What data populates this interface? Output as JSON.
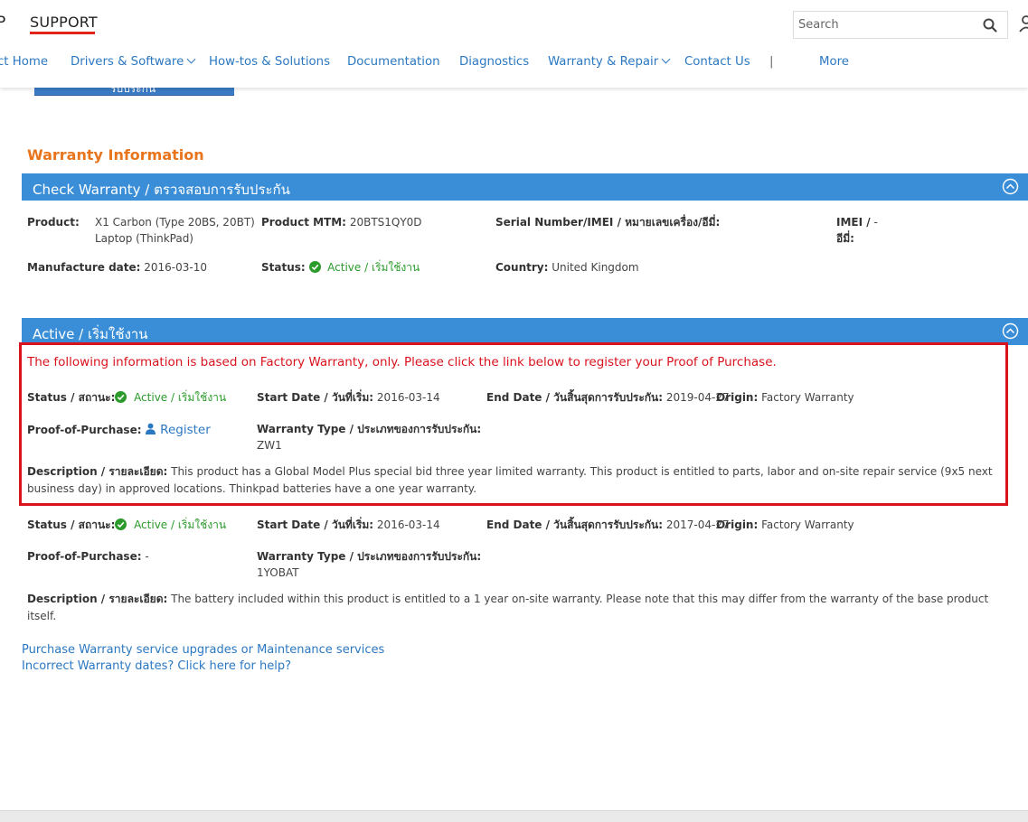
{
  "header": {
    "brand_fragment": "P",
    "support": "SUPPORT",
    "search_placeholder": "Search",
    "colors": {
      "accent": "#e2231a",
      "link": "#2b78c2"
    }
  },
  "nav": {
    "items": [
      {
        "label": "ct Home"
      },
      {
        "label": "Drivers & Software"
      },
      {
        "label": "How-tos & Solutions"
      },
      {
        "label": "Documentation"
      },
      {
        "label": "Diagnostics"
      },
      {
        "label": "Warranty & Repair"
      },
      {
        "label": "Contact Us"
      }
    ],
    "separator": "|",
    "more": "More"
  },
  "peek_button_label": "รับประกัน",
  "warranty": {
    "title": "Warranty Information",
    "check_bar": "Check Warranty / ตรวจสอบการรับประกัน",
    "product_label": "Product:",
    "product_value_line1": "X1 Carbon (Type 20BS, 20BT)",
    "product_value_line2": "Laptop (ThinkPad)",
    "mtm_label": "Product MTM:",
    "mtm_value": "20BTS1QY0D",
    "serial_label": "Serial Number/IMEI / หมายเลขเครื่อง/อีมี่:",
    "imei_label_line1": "IMEI /",
    "imei_label_line2": "อีมี่:",
    "imei_value": "-",
    "mfg_label": "Manufacture date:",
    "mfg_value": "2016-03-10",
    "status_label": "Status:",
    "status_value": "Active / เริ่มใช้งาน",
    "country_label": "Country:",
    "country_value": "United Kingdom"
  },
  "active": {
    "bar": "Active / เริ่มใช้งาน",
    "notice": "The following information is based on Factory Warranty, only. Please click the link below to register your Proof of Purchase.",
    "entries": [
      {
        "status_label": "Status / สถานะ:",
        "status_value": "Active / เริ่มใช้งาน",
        "start_label": "Start Date / วันที่เริ่ม:",
        "start_value": "2016-03-14",
        "end_label": "End Date / วันสิ้นสุดการรับประกัน:",
        "end_value": "2019-04-27",
        "origin_label": "Origin:",
        "origin_value": "Factory Warranty",
        "pop_label": "Proof-of-Purchase:",
        "pop_value": "Register",
        "type_label": "Warranty Type / ประเภทของการรับประกัน:",
        "type_value": "ZW1",
        "desc_label": "Description / รายละเอียด:",
        "desc_value": "This product has a Global Model Plus special bid three year limited warranty. This product is entitled to parts, labor and on-site repair service (9x5 next business day) in approved locations. Thinkpad batteries have a one year warranty."
      },
      {
        "status_label": "Status / สถานะ:",
        "status_value": "Active / เริ่มใช้งาน",
        "start_label": "Start Date / วันที่เริ่ม:",
        "start_value": "2016-03-14",
        "end_label": "End Date / วันสิ้นสุดการรับประกัน:",
        "end_value": "2017-04-27",
        "origin_label": "Origin:",
        "origin_value": "Factory Warranty",
        "pop_label": "Proof-of-Purchase:",
        "pop_value": "-",
        "type_label": "Warranty Type / ประเภทของการรับประกัน:",
        "type_value": "1YOBAT",
        "desc_label": "Description / รายละเอียด:",
        "desc_value": "The battery included within this product is entitled to a 1 year on-site warranty. Please note that this may differ from the warranty of the base product itself."
      }
    ]
  },
  "footer_links": {
    "purchase": "Purchase Warranty service upgrades or Maintenance services",
    "incorrect": "Incorrect Warranty dates? Click here for help?"
  },
  "colors": {
    "bar_blue": "#3a8ed8",
    "title_orange": "#e8741c",
    "alert_red": "#d9131d",
    "active_green": "#2a9a2a"
  }
}
